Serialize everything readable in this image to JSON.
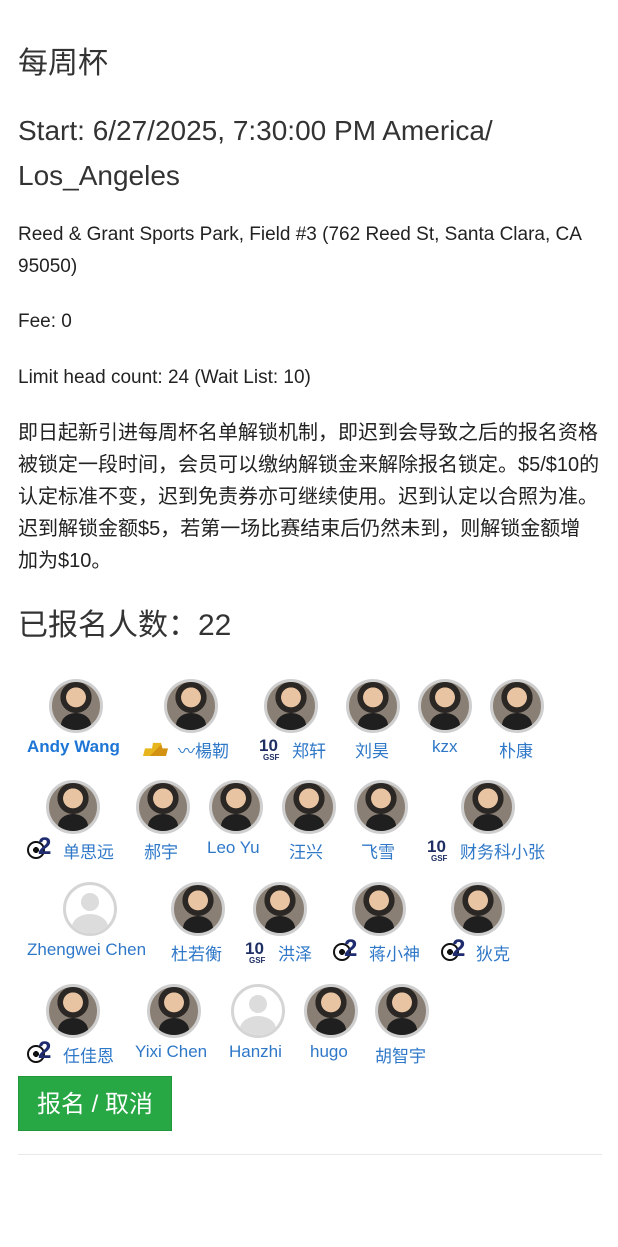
{
  "event": {
    "title": "每周杯",
    "start": "Start: 6/27/2025, 7:30:00 PM America/ Los_Angeles",
    "location": "Reed & Grant Sports Park, Field #3 (762 Reed St, Santa Clara, CA 95050)",
    "fee": "Fee: 0",
    "limit": "Limit head count: 24 (Wait List: 10)",
    "notice": "即日起新引进每周杯名单解锁机制，即迟到会导致之后的报名资格被锁定一段时间，会员可以缴纳解锁金来解除报名锁定。$5/$10的认定标准不变，迟到免责券亦可继续使用。迟到认定以合照为准。迟到解锁金额$5，若第一场比赛结束后仍然未到，则解锁金额增加为$10。",
    "registered": "已报名人数：22"
  },
  "players": [
    {
      "name": "Andy Wang"
    },
    {
      "name": "〰楊靭"
    },
    {
      "name": "郑轩"
    },
    {
      "name": "刘昊"
    },
    {
      "name": "kzx"
    },
    {
      "name": "朴康"
    },
    {
      "name": "单思远"
    },
    {
      "name": "郝宇"
    },
    {
      "name": "Leo Yu"
    },
    {
      "name": "汪兴"
    },
    {
      "name": "飞雪"
    },
    {
      "name": "财务科小张"
    },
    {
      "name": "Zhengwei Chen"
    },
    {
      "name": "杜若衡"
    },
    {
      "name": "洪泽"
    },
    {
      "name": "蒋小神"
    },
    {
      "name": "狄克"
    },
    {
      "name": "任佳恩"
    },
    {
      "name": "Yixi Chen"
    },
    {
      "name": "Hanzhi"
    },
    {
      "name": "hugo"
    },
    {
      "name": "胡智宇"
    }
  ],
  "badges": {
    "ten": "10",
    "gsf": "GSF",
    "two": "2"
  },
  "action": {
    "button": "报名 / 取消"
  },
  "colors": {
    "link": "#2f78c8",
    "button": "#28a745",
    "badge": "#1f2f63"
  }
}
